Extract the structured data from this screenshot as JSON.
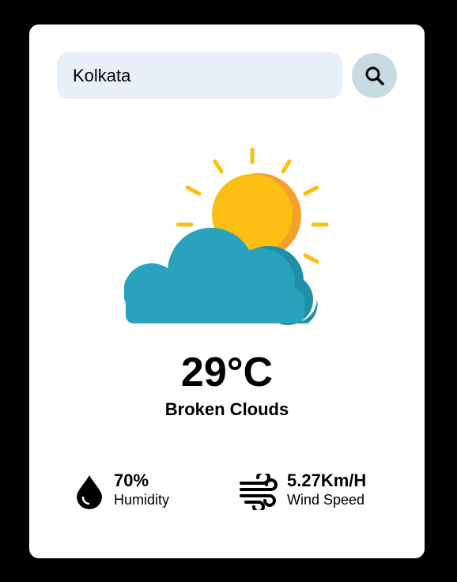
{
  "search": {
    "value": "Kolkata",
    "button_icon": "search-icon"
  },
  "weather": {
    "icon": "sun-behind-cloud-icon",
    "temperature": "29°C",
    "condition": "Broken Clouds"
  },
  "details": {
    "humidity": {
      "value": "70%",
      "label": "Humidity",
      "icon": "water-drop-icon"
    },
    "wind": {
      "value": "5.27Km/H",
      "label": "Wind Speed",
      "icon": "wind-icon"
    }
  },
  "colors": {
    "background": "#000000",
    "card": "#ffffff",
    "search_field": "#e8eff9",
    "search_button": "#c9dbe2",
    "sun": "#fbbf13",
    "sun_shade": "#f6a02b",
    "cloud": "#29a3bd",
    "cloud_shade": "#1e8fa8"
  }
}
